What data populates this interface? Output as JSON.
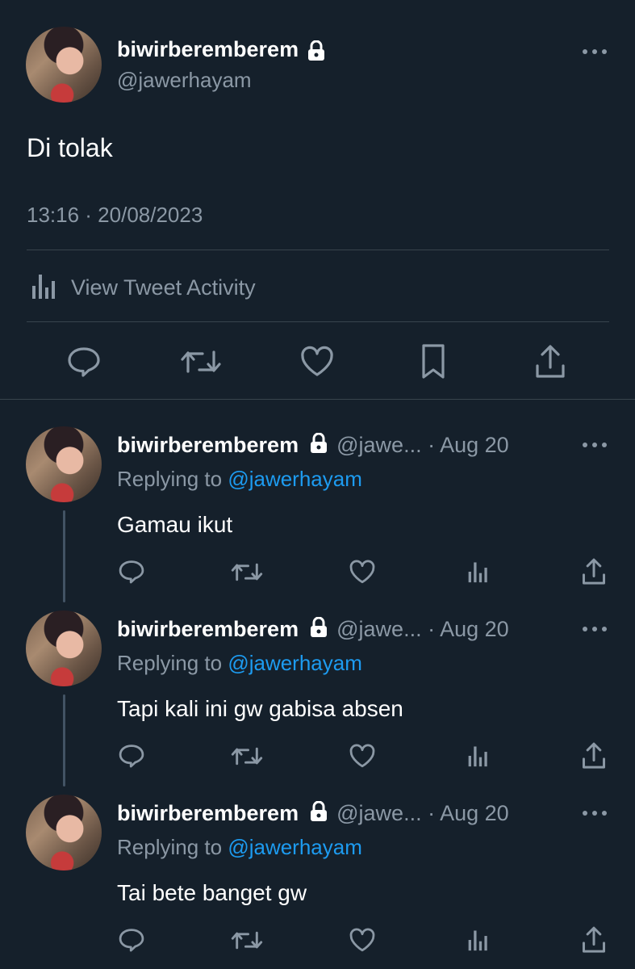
{
  "main_tweet": {
    "display_name": "biwirberemberem",
    "handle": "@jawerhayam",
    "text": "Di tolak",
    "timestamp": "13:16 · 20/08/2023",
    "activity_label": "View Tweet Activity"
  },
  "replies": [
    {
      "display_name": "biwirberemberem",
      "handle_truncated": "@jawe...",
      "dot": "·",
      "date": "Aug 20",
      "replying_prefix": "Replying to",
      "replying_to": "@jawerhayam",
      "text": "Gamau ikut"
    },
    {
      "display_name": "biwirberemberem",
      "handle_truncated": "@jawe...",
      "dot": "·",
      "date": "Aug 20",
      "replying_prefix": "Replying to",
      "replying_to": "@jawerhayam",
      "text": "Tapi kali ini gw gabisa absen"
    },
    {
      "display_name": "biwirberemberem",
      "handle_truncated": "@jawe...",
      "dot": "·",
      "date": "Aug 20",
      "replying_prefix": "Replying to",
      "replying_to": "@jawerhayam",
      "text": "Tai bete banget gw"
    }
  ],
  "icons": {
    "reply": "reply-icon",
    "retweet": "retweet-icon",
    "like": "heart-icon",
    "bookmark": "bookmark-icon",
    "share": "share-icon",
    "views": "views-icon",
    "lock": "lock-icon",
    "more": "more-icon"
  },
  "colors": {
    "background": "#15202b",
    "muted": "#8b98a5",
    "link": "#1d9bf0",
    "divider": "#38444d"
  }
}
